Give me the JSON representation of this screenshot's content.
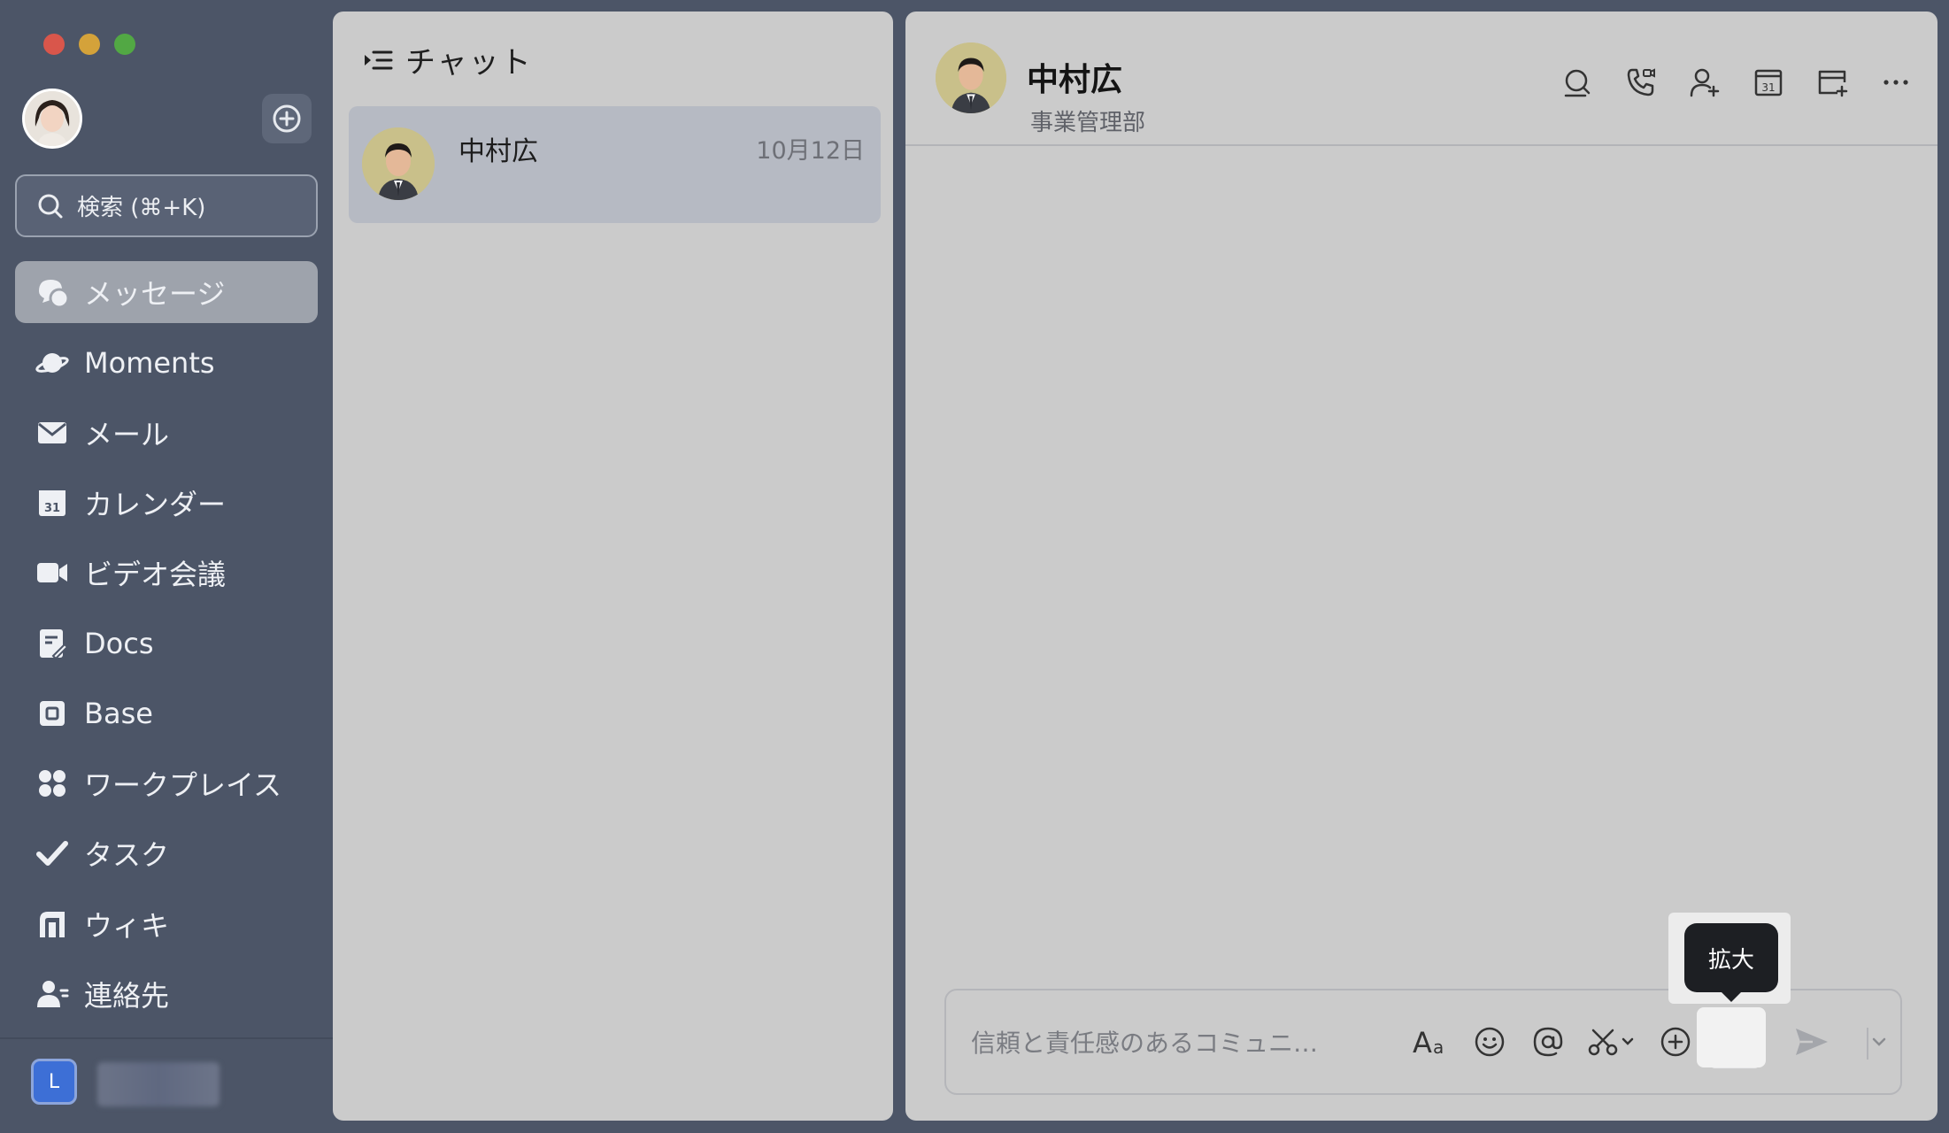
{
  "sidebar": {
    "search_placeholder": "検索 (⌘+K)",
    "items": [
      {
        "label": "メッセージ",
        "icon": "chat-bubbles-icon",
        "active": true
      },
      {
        "label": "Moments",
        "icon": "planet-icon"
      },
      {
        "label": "メール",
        "icon": "mail-icon"
      },
      {
        "label": "カレンダー",
        "icon": "calendar-icon"
      },
      {
        "label": "ビデオ会議",
        "icon": "video-camera-icon"
      },
      {
        "label": "Docs",
        "icon": "docs-icon"
      },
      {
        "label": "Base",
        "icon": "base-icon"
      },
      {
        "label": "ワークプレイス",
        "icon": "workplace-grid-icon"
      },
      {
        "label": "タスク",
        "icon": "task-check-icon"
      },
      {
        "label": "ウィキ",
        "icon": "wiki-icon"
      },
      {
        "label": "連絡先",
        "icon": "contacts-icon"
      }
    ],
    "workspace_initial": "L"
  },
  "chat_list": {
    "title": "チャット",
    "chats": [
      {
        "name": "中村広",
        "date": "10月12日"
      }
    ]
  },
  "conversation": {
    "name": "中村広",
    "department": "事業管理部",
    "composer_placeholder": "信頼と責任感のあるコミュニ…",
    "tooltip": "拡大"
  },
  "colors": {
    "sidebar_bg": "#4c5567",
    "panel_bg": "#cbcbcb",
    "selected_row": "#b6bac3",
    "accent_blue": "#3d6fd6"
  }
}
